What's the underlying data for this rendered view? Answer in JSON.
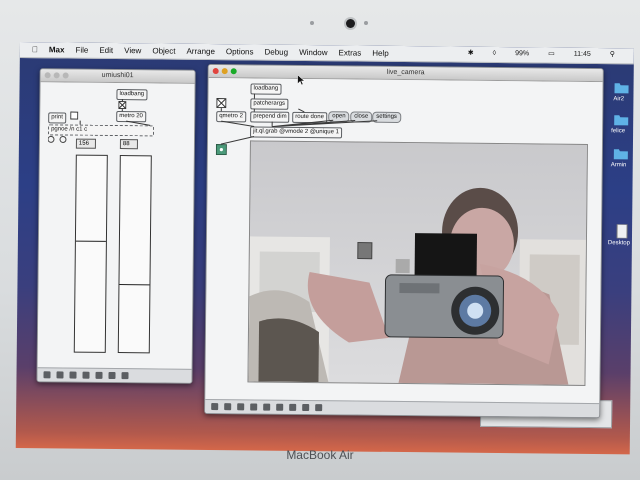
{
  "device": {
    "brand_label": "MacBook Air"
  },
  "menubar": {
    "app_name": "Max",
    "items": [
      "File",
      "Edit",
      "View",
      "Object",
      "Arrange",
      "Options",
      "Debug",
      "Window",
      "Extras",
      "Help"
    ],
    "battery": "99%",
    "clock": "11:45"
  },
  "desktop": {
    "icons": [
      {
        "label": "Air2",
        "icon": "folder-icon"
      },
      {
        "label": "felice",
        "icon": "folder-icon"
      },
      {
        "label": "Armin",
        "icon": "folder-icon"
      },
      {
        "label": "Desktop",
        "icon": "document-icon"
      }
    ]
  },
  "left_window": {
    "title": "umiushi01",
    "objects": {
      "loadbang": "loadbang",
      "metro": "metro 20",
      "print": "print",
      "cmd": "pgnoe /n c1 c"
    },
    "sliders": [
      {
        "value_label": "156",
        "level": 0.56
      },
      {
        "value_label": "88",
        "level": 0.34
      }
    ]
  },
  "main_window": {
    "title": "live_camera",
    "objects": {
      "loadbang": "loadbang",
      "metro": "qmetro 2",
      "patcherargs": "patcherargs",
      "prepend": "prepend dim",
      "route": "route done",
      "grab": "jit.ql.grab @vmode 2 @unique 1"
    },
    "messages": [
      "open",
      "close",
      "settings"
    ]
  },
  "colors": {
    "desktop_top": "#2b3a73",
    "desktop_bottom": "#d4674a",
    "close_light": "#e0443e",
    "minimize_light": "#dea123",
    "zoom_light": "#1aab29",
    "toggle_box": "#4b9a7a"
  }
}
